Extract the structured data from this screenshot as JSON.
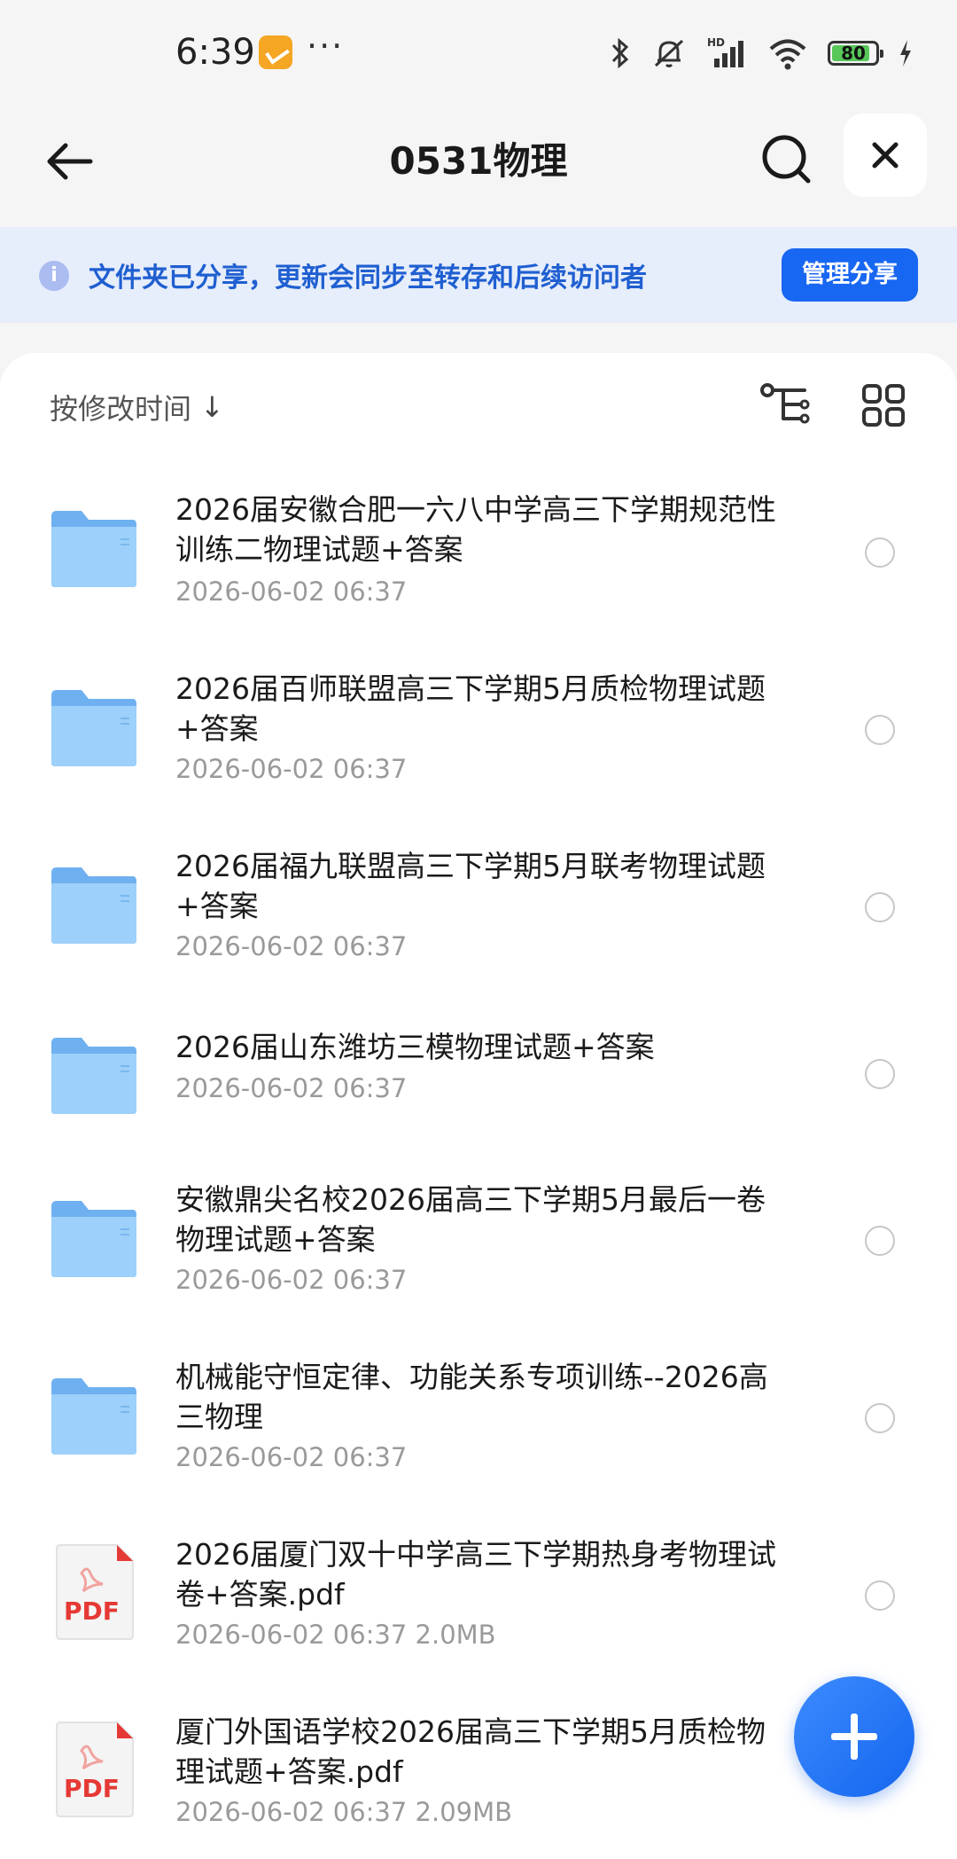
{
  "status_bar": {
    "time": "6:39",
    "more": "···",
    "battery": "80"
  },
  "header": {
    "title": "0531物理"
  },
  "banner": {
    "text": "文件夹已分享，更新会同步至转存和后续访问者",
    "manage_label": "管理分享"
  },
  "toolbar": {
    "sort_label": "按修改时间",
    "sort_arrow": "↓"
  },
  "files": [
    {
      "type": "folder",
      "name": "2026届安徽合肥一六八中学高三下学期规范性训练二物理试题+答案",
      "meta": "2026-06-02 06:37"
    },
    {
      "type": "folder",
      "name": "2026届百师联盟高三下学期5月质检物理试题+答案",
      "meta": "2026-06-02 06:37"
    },
    {
      "type": "folder",
      "name": "2026届福九联盟高三下学期5月联考物理试题+答案",
      "meta": "2026-06-02 06:37"
    },
    {
      "type": "folder",
      "name": "2026届山东潍坊三模物理试题+答案",
      "meta": "2026-06-02 06:37"
    },
    {
      "type": "folder",
      "name": "安徽鼎尖名校2026届高三下学期5月最后一卷物理试题+答案",
      "meta": "2026-06-02 06:37"
    },
    {
      "type": "folder",
      "name": "机械能守恒定律、功能关系专项训练--2026高三物理",
      "meta": "2026-06-02 06:37"
    },
    {
      "type": "pdf",
      "name": "2026届厦门双十中学高三下学期热身考物理试卷+答案.pdf",
      "meta": "2026-06-02 06:37  2.0MB"
    },
    {
      "type": "pdf",
      "name": "厦门外国语学校2026届高三下学期5月质检物理试题+答案.pdf",
      "meta": "2026-06-02 06:37  2.09MB"
    }
  ],
  "icons": {
    "pdf_label": "PDF",
    "colors": {
      "accent": "#1867f2",
      "folder": "#8cc4f7",
      "pdf_red": "#e53935"
    }
  }
}
